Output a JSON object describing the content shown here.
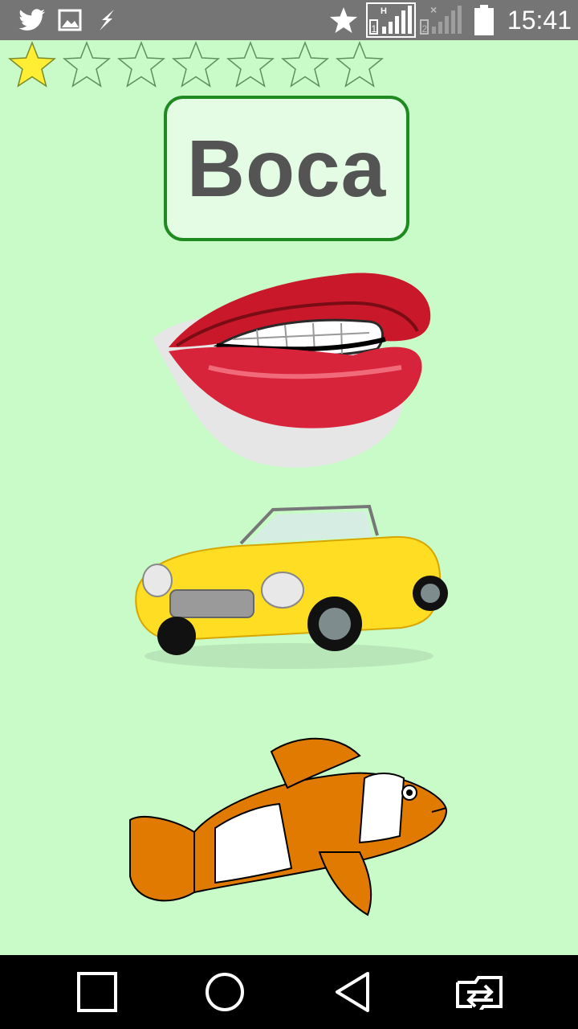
{
  "status_bar": {
    "time": "15:41",
    "icons": [
      "twitter-icon",
      "image-icon",
      "flash-icon",
      "star-icon",
      "signal-sim1-icon",
      "signal-sim2-icon",
      "battery-icon"
    ]
  },
  "progress": {
    "stars_filled": 1,
    "stars_total": 7
  },
  "word": "Boca",
  "options": [
    {
      "name": "mouth"
    },
    {
      "name": "car"
    },
    {
      "name": "clownfish"
    }
  ],
  "nav_bar": {
    "buttons": [
      "recents-button",
      "home-button",
      "back-button",
      "switch-button"
    ]
  },
  "colors": {
    "background": "#c9fbc9",
    "card_border": "#1f8a1f",
    "card_fill": "#e4fce4",
    "word_text": "#545454",
    "star_filled": "#ffee33"
  }
}
